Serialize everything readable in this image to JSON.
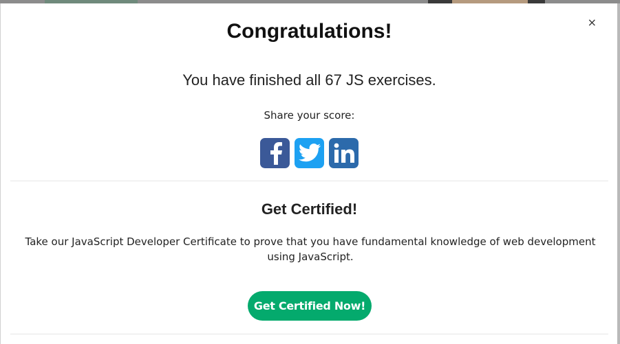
{
  "modal": {
    "close_label": "×",
    "title": "Congratulations!",
    "finished_text": "You have finished all 67 JS exercises.",
    "share_label": "Share your score:",
    "share_icons": [
      {
        "name": "facebook-icon",
        "color": "#3b5998"
      },
      {
        "name": "twitter-icon",
        "color": "#1da1f2"
      },
      {
        "name": "linkedin-icon",
        "color": "#2c6aab"
      }
    ],
    "cert_title": "Get Certified!",
    "cert_description": "Take our JavaScript Developer Certificate to prove that you have fundamental knowledge of web development using JavaScript.",
    "cta_label": "Get Certified Now!",
    "cta_color": "#04aa6d"
  }
}
